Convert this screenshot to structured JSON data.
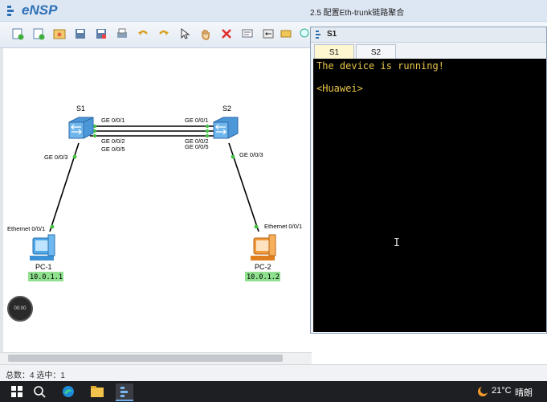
{
  "app": {
    "name": "eNSP",
    "window_title": "2.5 配置Eth-trunk链路聚合"
  },
  "toolbar": {
    "icons": [
      "new-topology-icon",
      "new-exam-icon",
      "open-icon",
      "save-icon",
      "save-as-icon",
      "print-icon",
      "undo-icon",
      "redo-icon",
      "select-icon",
      "pan-hand-icon",
      "delete-icon",
      "text-annotation-icon",
      "palette-icon",
      "rectangle-icon"
    ]
  },
  "topology": {
    "devices": [
      {
        "id": "S1",
        "label": "S1",
        "type": "switch"
      },
      {
        "id": "S2",
        "label": "S2",
        "type": "switch"
      },
      {
        "id": "PC1",
        "label": "PC-1",
        "ip": "10.0.1.1",
        "type": "pc"
      },
      {
        "id": "PC2",
        "label": "PC-2",
        "ip": "10.0.1.2",
        "type": "pc"
      }
    ],
    "port_labels": {
      "s1_ge001": "GE 0/0/1",
      "s1_ge002": "GE 0/0/2",
      "s1_ge005": "GE 0/0/5",
      "s2_ge001": "GE 0/0/1",
      "s2_ge002": "GE 0/0/2",
      "s2_ge005": "GE 0/0/5",
      "s1_ge003": "GE 0/0/3",
      "s2_ge003": "GE 0/0/3",
      "pc1_eth": "Ethernet 0/0/1",
      "pc2_eth": "Ethernet 0/0/1"
    }
  },
  "recording": {
    "timer": "00:00"
  },
  "statusbar": {
    "text": "总数：4 选中：1"
  },
  "terminal": {
    "title": "S1",
    "tabs": [
      {
        "label": "S1",
        "active": true
      },
      {
        "label": "S2",
        "active": false
      }
    ],
    "lines": [
      "The device is running!",
      "",
      "<Huawei>"
    ],
    "text_color": "#e8c64a"
  },
  "taskbar": {
    "apps": [
      "windows-start-icon",
      "search-icon",
      "edge-browser-icon",
      "file-explorer-icon",
      "ensp-app-icon"
    ],
    "weather": {
      "temp": "21°C",
      "condition": "晴朗"
    }
  },
  "colors": {
    "link": "#000000",
    "port_dot": "#44c044",
    "ip_badge": "#8fe08f",
    "switch_blue": "#5aa8e0"
  }
}
